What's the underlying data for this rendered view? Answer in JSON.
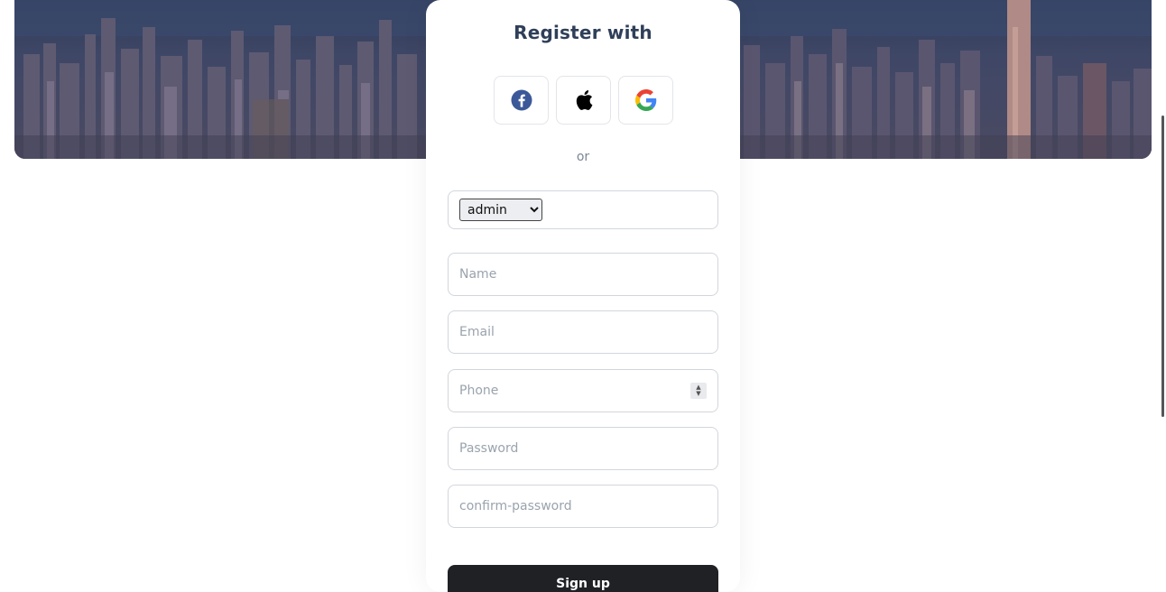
{
  "card": {
    "title": "Register with",
    "or_text": "or"
  },
  "social": {
    "facebook": "facebook-icon",
    "apple": "apple-icon",
    "google": "google-icon"
  },
  "form": {
    "role_selected": "admin",
    "role_options": [
      "admin"
    ],
    "name_placeholder": "Name",
    "email_placeholder": "Email",
    "phone_placeholder": "Phone",
    "password_placeholder": "Password",
    "confirm_placeholder": "confirm-password",
    "submit_label": "Sign up"
  },
  "colors": {
    "title": "#2f3f59",
    "button_bg": "#1f2125",
    "facebook": "#3b5998"
  }
}
